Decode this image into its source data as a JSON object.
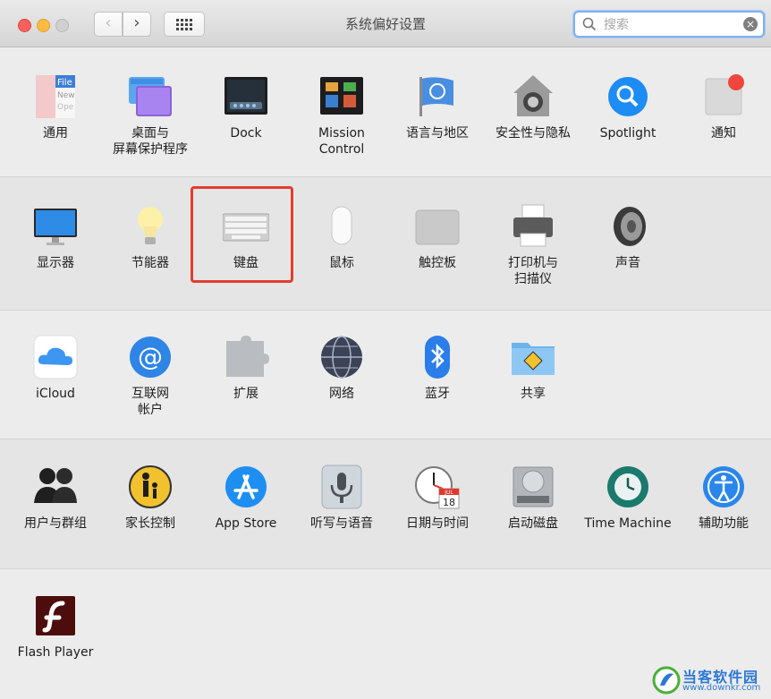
{
  "window": {
    "title": "系统偏好设置"
  },
  "search": {
    "placeholder": "搜索"
  },
  "rows": [
    [
      {
        "label": "通用",
        "icon": "general-icon"
      },
      {
        "label": "桌面与\n屏幕保护程序",
        "icon": "desktop-screensaver-icon"
      },
      {
        "label": "Dock",
        "icon": "dock-icon"
      },
      {
        "label": "Mission\nControl",
        "icon": "mission-control-icon"
      },
      {
        "label": "语言与地区",
        "icon": "language-region-icon"
      },
      {
        "label": "安全性与隐私",
        "icon": "security-privacy-icon"
      },
      {
        "label": "Spotlight",
        "icon": "spotlight-icon"
      },
      {
        "label": "通知",
        "icon": "notifications-icon"
      }
    ],
    [
      {
        "label": "显示器",
        "icon": "displays-icon"
      },
      {
        "label": "节能器",
        "icon": "energy-saver-icon"
      },
      {
        "label": "键盘",
        "icon": "keyboard-icon"
      },
      {
        "label": "鼠标",
        "icon": "mouse-icon"
      },
      {
        "label": "触控板",
        "icon": "trackpad-icon"
      },
      {
        "label": "打印机与\n扫描仪",
        "icon": "printers-scanners-icon"
      },
      {
        "label": "声音",
        "icon": "sound-icon"
      }
    ],
    [
      {
        "label": "iCloud",
        "icon": "icloud-icon"
      },
      {
        "label": "互联网\n帐户",
        "icon": "internet-accounts-icon"
      },
      {
        "label": "扩展",
        "icon": "extensions-icon"
      },
      {
        "label": "网络",
        "icon": "network-icon"
      },
      {
        "label": "蓝牙",
        "icon": "bluetooth-icon"
      },
      {
        "label": "共享",
        "icon": "sharing-icon"
      }
    ],
    [
      {
        "label": "用户与群组",
        "icon": "users-groups-icon"
      },
      {
        "label": "家长控制",
        "icon": "parental-controls-icon"
      },
      {
        "label": "App Store",
        "icon": "app-store-icon"
      },
      {
        "label": "听写与语音",
        "icon": "dictation-speech-icon"
      },
      {
        "label": "日期与时间",
        "icon": "date-time-icon"
      },
      {
        "label": "启动磁盘",
        "icon": "startup-disk-icon"
      },
      {
        "label": "Time Machine",
        "icon": "time-machine-icon"
      },
      {
        "label": "辅助功能",
        "icon": "accessibility-icon"
      }
    ],
    [
      {
        "label": "Flash Player",
        "icon": "flash-player-icon"
      }
    ]
  ],
  "icon_text": {
    "general": [
      "File",
      "New",
      "Ope"
    ],
    "calendar_month": "JUL",
    "calendar_day": "18"
  },
  "watermark": {
    "title": "当客软件园",
    "url": "www.downkr.com"
  },
  "colors": {
    "highlight": "#e23e2c",
    "search_focus": "#7fb0ef"
  }
}
